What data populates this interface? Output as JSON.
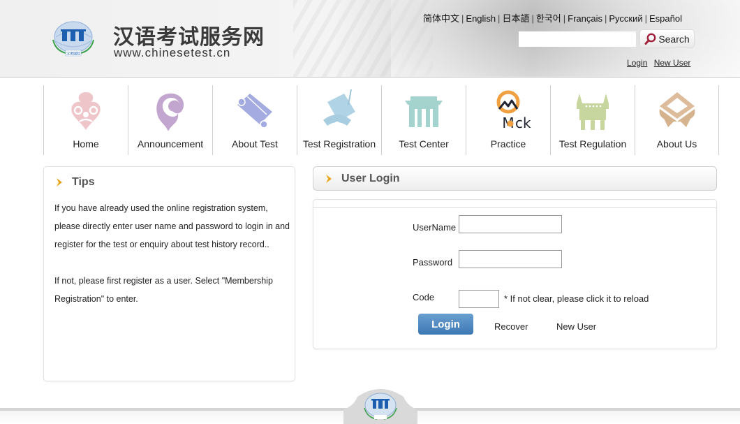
{
  "header": {
    "site_title": "汉语考试服务网",
    "site_url": "www.chinesetest.cn",
    "logo_caption": "汉考国际",
    "languages": [
      "简体中文",
      "English",
      "日本語",
      "한국어",
      "Français",
      "Русский",
      "Español"
    ],
    "search": {
      "placeholder": "",
      "value": "",
      "button_label": "Search"
    },
    "links": {
      "login": "Login",
      "new_user": "New User"
    }
  },
  "nav": {
    "items": [
      {
        "label": "Home",
        "icon": "home-ornament-icon",
        "color": "#e8b9bd"
      },
      {
        "label": "Announcement",
        "icon": "announcement-cloud-icon",
        "color": "#b9a0c9"
      },
      {
        "label": "About Test",
        "icon": "scroll-icon",
        "color": "#9aa4dc"
      },
      {
        "label": "Test Registration",
        "icon": "registration-scroll-icon",
        "color": "#a9cde0"
      },
      {
        "label": "Test Center",
        "icon": "gate-icon",
        "color": "#9fcfc8"
      },
      {
        "label": "Practice",
        "icon": "mock-logo-icon",
        "color": "#f0a040"
      },
      {
        "label": "Test Regulation",
        "icon": "bronze-vessel-icon",
        "color": "#c3d39a"
      },
      {
        "label": "About Us",
        "icon": "table-stand-icon",
        "color": "#d9b896"
      }
    ]
  },
  "tips": {
    "title": "Tips",
    "paragraphs": [
      "If you have already used the online registration system, please directly enter user name and password to login in and register for the test or enquiry about test history record..",
      "If not, please first register as a user. Select \"Membership Registration\" to enter."
    ]
  },
  "login": {
    "title": "User Login",
    "username_label": "UserName",
    "username_value": "",
    "password_label": "Password",
    "password_value": "",
    "code_label": "Code",
    "code_value": "",
    "code_hint": "*  If not clear, please click it to reload",
    "login_button": "Login",
    "recover_link": "Recover",
    "new_user_link": "New User"
  },
  "colors": {
    "accent_chevron": "#e7a51c",
    "login_button": "#4a85bf",
    "search_icon": "#a0203a"
  }
}
